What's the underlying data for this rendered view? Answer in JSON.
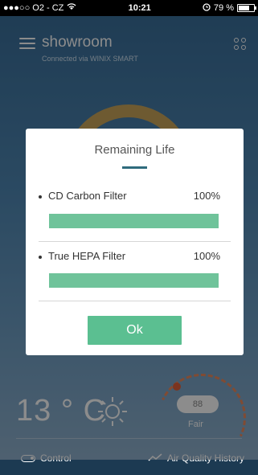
{
  "status_bar": {
    "carrier": "●●●○○ O2 - CZ",
    "time": "10:21",
    "battery": "79 %",
    "battery_level": 0.79
  },
  "app": {
    "title": "showroom",
    "subtitle": "Connected via WINIX SMART",
    "temperature": "13 ° C",
    "air_quality_value": "88",
    "air_quality_label": "Fair",
    "bottom_nav": {
      "control_label": "Control",
      "history_label": "Air Quality History"
    }
  },
  "modal": {
    "title": "Remaining Life",
    "filters": [
      {
        "name": "CD Carbon Filter",
        "percent": "100%",
        "level": 1.0
      },
      {
        "name": "True HEPA Filter",
        "percent": "100%",
        "level": 1.0
      }
    ],
    "ok_label": "Ok"
  },
  "colors": {
    "accent_green": "#5bbf91",
    "bar_green": "#6fc39a",
    "ring_gold": "#c8a45a",
    "title_bar": "#2f6b7d"
  }
}
